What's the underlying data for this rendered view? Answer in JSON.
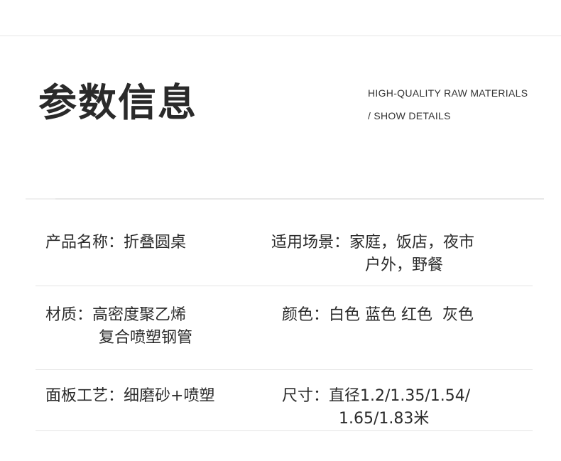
{
  "header": {
    "title": "参数信息",
    "subtitle_line1": "HIGH-QUALITY RAW MATERIALS",
    "subtitle_line2": "/ SHOW DETAILS"
  },
  "specs": {
    "product_name": {
      "label": "产品名称：",
      "value": "折叠圆桌"
    },
    "scenario": {
      "label": "适用场景：",
      "value": "家庭，饭店，夜市",
      "value_cont": "户外，野餐"
    },
    "material": {
      "label": "材质：",
      "value": "高密度聚乙烯",
      "value_cont": "复合喷塑钢管"
    },
    "color": {
      "label": "颜色：",
      "value": "白色 蓝色 红色  灰色"
    },
    "craft": {
      "label": "面板工艺：",
      "value": "细磨砂+喷塑"
    },
    "size": {
      "label": "尺寸：",
      "value": "直径1.2/1.35/1.54/",
      "value_cont": "1.65/1.83米"
    }
  }
}
